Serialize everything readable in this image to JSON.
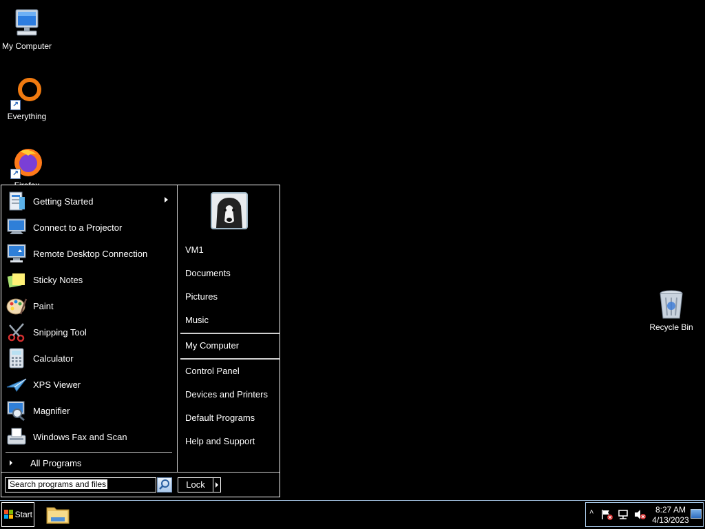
{
  "desktop": {
    "icons": [
      {
        "label": "My Computer",
        "icon": "computer-icon"
      },
      {
        "label": "Everything",
        "icon": "everything-icon"
      },
      {
        "label": "Firefox",
        "icon": "firefox-icon"
      },
      {
        "label": "Recycle Bin",
        "icon": "recycle-bin-icon"
      }
    ]
  },
  "start_menu": {
    "programs": [
      {
        "label": "Getting Started",
        "icon": "getting-started-icon",
        "has_submenu": true
      },
      {
        "label": "Connect to a Projector",
        "icon": "projector-icon"
      },
      {
        "label": "Remote Desktop Connection",
        "icon": "remote-desktop-icon"
      },
      {
        "label": "Sticky Notes",
        "icon": "sticky-notes-icon"
      },
      {
        "label": "Paint",
        "icon": "paint-icon"
      },
      {
        "label": "Snipping Tool",
        "icon": "snipping-tool-icon"
      },
      {
        "label": "Calculator",
        "icon": "calculator-icon"
      },
      {
        "label": "XPS Viewer",
        "icon": "xps-viewer-icon"
      },
      {
        "label": "Magnifier",
        "icon": "magnifier-icon"
      },
      {
        "label": "Windows Fax and Scan",
        "icon": "fax-scan-icon"
      }
    ],
    "all_programs": "All Programs",
    "right_items": [
      "VM1",
      "Documents",
      "Pictures",
      "Music",
      "My Computer",
      "Control Panel",
      "Devices and Printers",
      "Default Programs",
      "Help and Support"
    ],
    "search_placeholder": "Search programs and files",
    "lock_label": "Lock"
  },
  "taskbar": {
    "start_label": "Start",
    "time": "8:27 AM",
    "date": "4/13/2023"
  }
}
